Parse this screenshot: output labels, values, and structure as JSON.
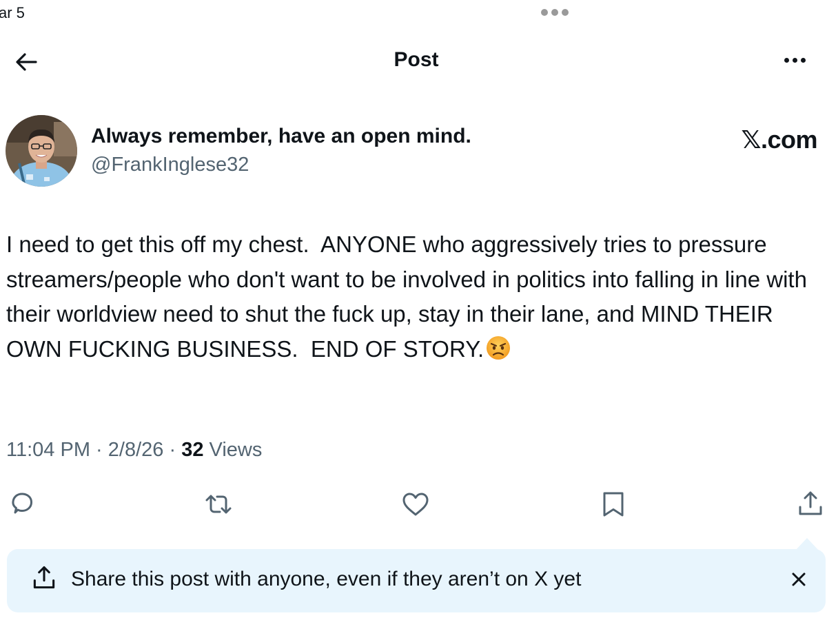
{
  "status_bar": {
    "left_text": "ar 5"
  },
  "header": {
    "title": "Post"
  },
  "author": {
    "display_name": "Always remember, have an open mind.",
    "handle": "@FrankInglese32"
  },
  "brand": "𝕏.com",
  "post": {
    "text": "I need to get this off my chest.  ANYONE who aggressively tries to pressure streamers/people who don't want to be involved in politics into falling in line with their worldview need to shut the fuck up, stay in their lane, and MIND THEIR OWN FUCKING BUSINESS.  END OF STORY.",
    "emoji": "angry-face-emoji",
    "time": "11:04 PM",
    "date": "2/8/26",
    "separator": " · ",
    "views_count": "32",
    "views_label": " Views"
  },
  "actions": [
    {
      "icon": "reply-icon"
    },
    {
      "icon": "repost-icon"
    },
    {
      "icon": "like-icon"
    },
    {
      "icon": "bookmark-icon"
    },
    {
      "icon": "share-icon"
    }
  ],
  "share_banner": {
    "text": "Share this post with anyone, even if they aren’t on X yet",
    "icon": "share-icon",
    "close_icon": "close-icon"
  },
  "colors": {
    "text": "#0f1419",
    "secondary": "#536471",
    "banner_bg": "#e8f5fd",
    "icon": "#536471"
  }
}
